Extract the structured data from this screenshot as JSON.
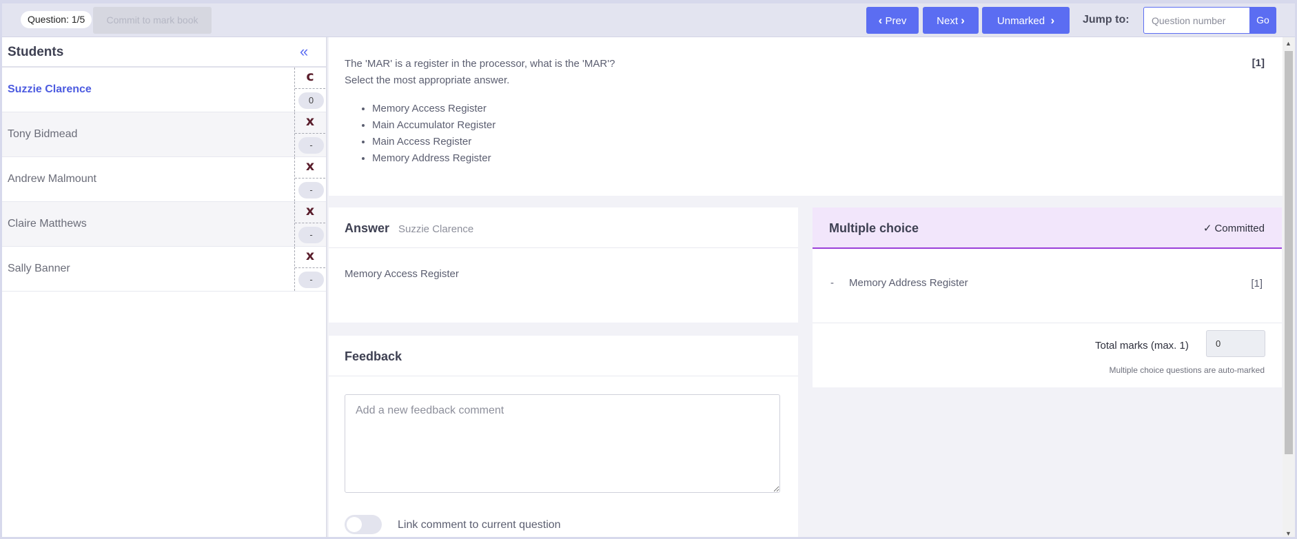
{
  "topbar": {
    "question_indicator": "Question: 1/5",
    "commit_label": "Commit to mark book",
    "prev_label": "Prev",
    "next_label": "Next",
    "unmarked_label": "Unmarked",
    "jump_label": "Jump to:",
    "jump_placeholder": "Question number",
    "go_label": "Go"
  },
  "sidebar": {
    "title": "Students",
    "students": [
      {
        "name": "Suzzie Clarence",
        "status": "c",
        "score": "0"
      },
      {
        "name": "Tony Bidmead",
        "status": "x",
        "score": "-"
      },
      {
        "name": "Andrew Malmount",
        "status": "x",
        "score": "-"
      },
      {
        "name": "Claire Matthews",
        "status": "x",
        "score": "-"
      },
      {
        "name": "Sally Banner",
        "status": "x",
        "score": "-"
      }
    ]
  },
  "question": {
    "line1": "The 'MAR' is a register in the processor, what is the 'MAR'?",
    "line2": "Select the most appropriate answer.",
    "marks": "[1]",
    "options": [
      "Memory Access Register",
      "Main Accumulator Register",
      "Main Access Register",
      "Memory Address Register"
    ]
  },
  "answer": {
    "title": "Answer",
    "student": "Suzzie Clarence",
    "text": "Memory Access Register"
  },
  "feedback": {
    "title": "Feedback",
    "placeholder": "Add a new feedback comment",
    "toggle_label": "Link comment to current question"
  },
  "multiple_choice": {
    "title": "Multiple choice",
    "status": "Committed",
    "dash": "-",
    "correct_answer": "Memory Address Register",
    "answer_mark": "[1]",
    "total_label": "Total marks (max. 1)",
    "total_value": "0",
    "note": "Multiple choice questions are auto-marked"
  },
  "colors": {
    "accent": "#5b6df2",
    "committed_border": "#9b3fd9",
    "status_mark": "#5a1e2c"
  }
}
